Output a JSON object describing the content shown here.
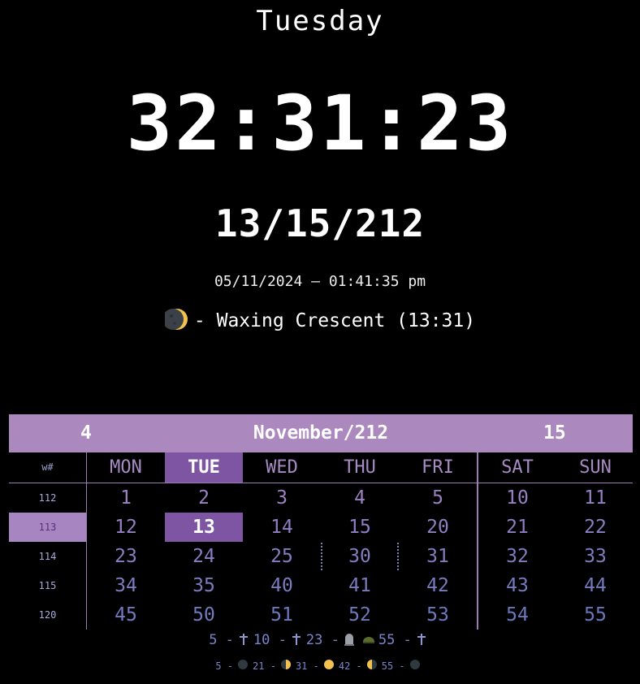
{
  "header": {
    "day_name": "Tuesday",
    "clock": "32:31:23",
    "alt_date": "13/15/212",
    "real_datetime": "05/11/2024 — 01:41:35 pm",
    "moon_phase_text": "- Waxing Crescent (13:31)",
    "moon_icon": "waxing-crescent-moon-icon"
  },
  "calendar": {
    "header_left": "4",
    "header_title": "November/212",
    "header_right": "15",
    "week_col_label": "w#",
    "days": [
      "MON",
      "TUE",
      "WED",
      "THU",
      "FRI",
      "SAT",
      "SUN"
    ],
    "today_col": 1,
    "today_row": 1,
    "current_week_row": 1,
    "weeks": [
      "112",
      "113",
      "114",
      "115",
      "120"
    ],
    "rows": [
      [
        "1",
        "2",
        "3",
        "4",
        "5",
        "10",
        "11"
      ],
      [
        "12",
        "13",
        "14",
        "15",
        "20",
        "21",
        "22"
      ],
      [
        "23",
        "24",
        "25",
        "30",
        "31",
        "32",
        "33"
      ],
      [
        "34",
        "35",
        "40",
        "41",
        "42",
        "43",
        "44"
      ],
      [
        "45",
        "50",
        "51",
        "52",
        "53",
        "54",
        "55"
      ]
    ],
    "colors": {
      "header_bg": "#ab88bd",
      "today_bg": "#7e55a2",
      "current_week_bg": "#a785c0",
      "number_color": "#6f7fc0",
      "day_label_color": "#a88bc4"
    }
  },
  "legend": {
    "events_line": [
      {
        "text": "5 -",
        "icon": "cross-icon"
      },
      {
        "text": "10 -",
        "icon": "cross-icon"
      },
      {
        "text": "23 -",
        "icon": "tombstone-icon"
      },
      {
        "text": "",
        "icon": "helmet-icon"
      },
      {
        "text": "55 -",
        "icon": "cross-icon"
      }
    ],
    "moon_line": [
      {
        "text": "5 -",
        "icon": "new-moon-icon"
      },
      {
        "text": "21 -",
        "icon": "first-quarter-moon-icon"
      },
      {
        "text": "31 -",
        "icon": "full-moon-icon"
      },
      {
        "text": "42 -",
        "icon": "last-quarter-moon-icon"
      },
      {
        "text": "55 -",
        "icon": "new-moon-icon"
      }
    ]
  }
}
